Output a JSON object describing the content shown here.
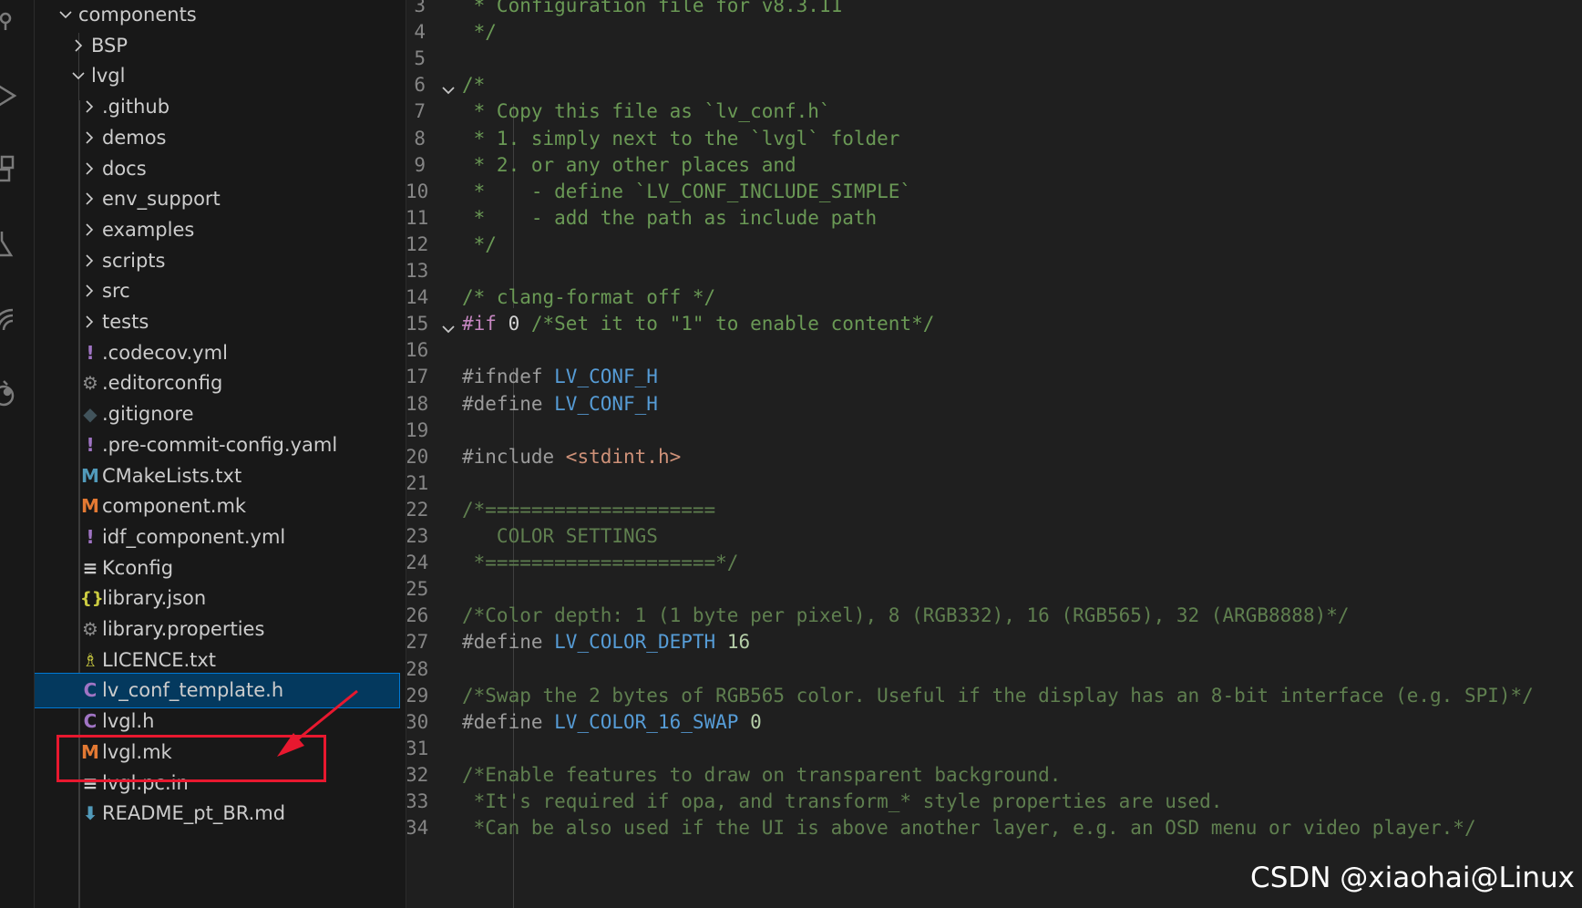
{
  "explorer": {
    "rows": [
      {
        "label": "components",
        "kind": "folder-open",
        "depth": 0,
        "icon": "chevron-down-icon"
      },
      {
        "label": "BSP",
        "kind": "folder",
        "depth": 1,
        "icon": "chevron-right-icon"
      },
      {
        "label": "lvgl",
        "kind": "folder-open",
        "depth": 1,
        "icon": "chevron-down-icon"
      },
      {
        "label": ".github",
        "kind": "folder",
        "depth": 2,
        "icon": "chevron-right-icon"
      },
      {
        "label": "demos",
        "kind": "folder",
        "depth": 2,
        "icon": "chevron-right-icon"
      },
      {
        "label": "docs",
        "kind": "folder",
        "depth": 2,
        "icon": "chevron-right-icon"
      },
      {
        "label": "env_support",
        "kind": "folder",
        "depth": 2,
        "icon": "chevron-right-icon"
      },
      {
        "label": "examples",
        "kind": "folder",
        "depth": 2,
        "icon": "chevron-right-icon"
      },
      {
        "label": "scripts",
        "kind": "folder",
        "depth": 2,
        "icon": "chevron-right-icon"
      },
      {
        "label": "src",
        "kind": "folder",
        "depth": 2,
        "icon": "chevron-right-icon"
      },
      {
        "label": "tests",
        "kind": "folder",
        "depth": 2,
        "icon": "chevron-right-icon"
      },
      {
        "label": ".codecov.yml",
        "kind": "file",
        "depth": 2,
        "icon": "yaml-icon",
        "glyph": "!",
        "color": "#a074c4"
      },
      {
        "label": ".editorconfig",
        "kind": "file",
        "depth": 2,
        "icon": "gear-icon",
        "glyph": "⚙",
        "color": "#8a8a8a"
      },
      {
        "label": ".gitignore",
        "kind": "file",
        "depth": 2,
        "icon": "git-icon",
        "glyph": "◆",
        "color": "#41535b"
      },
      {
        "label": ".pre-commit-config.yaml",
        "kind": "file",
        "depth": 2,
        "icon": "yaml-icon",
        "glyph": "!",
        "color": "#a074c4"
      },
      {
        "label": "CMakeLists.txt",
        "kind": "file",
        "depth": 2,
        "icon": "cmake-icon",
        "glyph": "M",
        "color": "#519aba"
      },
      {
        "label": "component.mk",
        "kind": "file",
        "depth": 2,
        "icon": "makefile-icon",
        "glyph": "M",
        "color": "#e37933"
      },
      {
        "label": "idf_component.yml",
        "kind": "file",
        "depth": 2,
        "icon": "yaml-icon",
        "glyph": "!",
        "color": "#a074c4"
      },
      {
        "label": "Kconfig",
        "kind": "file",
        "depth": 2,
        "icon": "text-lines-icon",
        "glyph": "≡",
        "color": "#cccccc"
      },
      {
        "label": "library.json",
        "kind": "file",
        "depth": 2,
        "icon": "json-icon",
        "glyph": "{}",
        "color": "#cbcb41"
      },
      {
        "label": "library.properties",
        "kind": "file",
        "depth": 2,
        "icon": "gear-icon",
        "glyph": "⚙",
        "color": "#8a8a8a"
      },
      {
        "label": "LICENCE.txt",
        "kind": "file",
        "depth": 2,
        "icon": "license-icon",
        "glyph": "♗",
        "color": "#cbcb41"
      },
      {
        "label": "lv_conf_template.h",
        "kind": "file",
        "depth": 2,
        "icon": "c-header-icon",
        "glyph": "C",
        "color": "#a074c4",
        "selected": true
      },
      {
        "label": "lvgl.h",
        "kind": "file",
        "depth": 2,
        "icon": "c-header-icon",
        "glyph": "C",
        "color": "#a074c4"
      },
      {
        "label": "lvgl.mk",
        "kind": "file",
        "depth": 2,
        "icon": "makefile-icon",
        "glyph": "M",
        "color": "#e37933"
      },
      {
        "label": "lvgl.pc.in",
        "kind": "file",
        "depth": 2,
        "icon": "text-lines-icon",
        "glyph": "≡",
        "color": "#cccccc"
      },
      {
        "label": "README_pt_BR.md",
        "kind": "file",
        "depth": 2,
        "icon": "markdown-icon",
        "glyph": "⬇",
        "color": "#519aba"
      }
    ]
  },
  "editor": {
    "lines": [
      {
        "n": "3",
        "fold": "",
        "tokens": [
          [
            "cm",
            " * Configuration file for v8.3.11"
          ]
        ]
      },
      {
        "n": "4",
        "fold": "",
        "tokens": [
          [
            "cm",
            " */"
          ]
        ]
      },
      {
        "n": "5",
        "fold": "",
        "tokens": []
      },
      {
        "n": "6",
        "fold": "open",
        "tokens": [
          [
            "cm",
            "/*"
          ]
        ]
      },
      {
        "n": "7",
        "fold": "",
        "tokens": [
          [
            "cm",
            " * Copy this file as `lv_conf.h`"
          ]
        ]
      },
      {
        "n": "8",
        "fold": "",
        "tokens": [
          [
            "cm",
            " * 1. simply next to the `lvgl` folder"
          ]
        ]
      },
      {
        "n": "9",
        "fold": "",
        "tokens": [
          [
            "cm",
            " * 2. or any other places and"
          ]
        ]
      },
      {
        "n": "10",
        "fold": "",
        "tokens": [
          [
            "cm",
            " *    - define `LV_CONF_INCLUDE_SIMPLE`"
          ]
        ]
      },
      {
        "n": "11",
        "fold": "",
        "tokens": [
          [
            "cm",
            " *    - add the path as include path"
          ]
        ]
      },
      {
        "n": "12",
        "fold": "",
        "tokens": [
          [
            "cm",
            " */"
          ]
        ]
      },
      {
        "n": "13",
        "fold": "",
        "tokens": []
      },
      {
        "n": "14",
        "fold": "",
        "tokens": [
          [
            "cm",
            "/* clang-format off */"
          ]
        ]
      },
      {
        "n": "15",
        "fold": "open",
        "tokens": [
          [
            "kw",
            "#if"
          ],
          [
            "def",
            " 0 "
          ],
          [
            "cm",
            "/*Set it to \"1\" to enable content*/"
          ]
        ]
      },
      {
        "n": "16",
        "fold": "",
        "tokens": []
      },
      {
        "n": "17",
        "fold": "",
        "tokens": [
          [
            "pp",
            "#ifndef "
          ],
          [
            "mac",
            "LV_CONF_H"
          ]
        ]
      },
      {
        "n": "18",
        "fold": "",
        "tokens": [
          [
            "pp",
            "#define "
          ],
          [
            "mac",
            "LV_CONF_H"
          ]
        ]
      },
      {
        "n": "19",
        "fold": "",
        "tokens": []
      },
      {
        "n": "20",
        "fold": "",
        "tokens": [
          [
            "pp",
            "#include "
          ],
          [
            "str",
            "<stdint.h>"
          ]
        ]
      },
      {
        "n": "21",
        "fold": "",
        "tokens": []
      },
      {
        "n": "22",
        "fold": "",
        "tokens": [
          [
            "dim",
            "/*===================="
          ]
        ]
      },
      {
        "n": "23",
        "fold": "",
        "tokens": [
          [
            "dim",
            "   COLOR SETTINGS"
          ]
        ]
      },
      {
        "n": "24",
        "fold": "",
        "tokens": [
          [
            "dim",
            " *====================*/"
          ]
        ]
      },
      {
        "n": "25",
        "fold": "",
        "tokens": []
      },
      {
        "n": "26",
        "fold": "",
        "tokens": [
          [
            "dim",
            "/*Color depth: 1 (1 byte per pixel), 8 (RGB332), 16 (RGB565), 32 (ARGB8888)*/"
          ]
        ]
      },
      {
        "n": "27",
        "fold": "",
        "tokens": [
          [
            "pp",
            "#define "
          ],
          [
            "mac",
            "LV_COLOR_DEPTH"
          ],
          [
            "num",
            " 16"
          ]
        ]
      },
      {
        "n": "28",
        "fold": "",
        "tokens": []
      },
      {
        "n": "29",
        "fold": "",
        "tokens": [
          [
            "dim",
            "/*Swap the 2 bytes of RGB565 color. Useful if the display has an 8-bit interface (e.g. SPI)*/"
          ]
        ]
      },
      {
        "n": "30",
        "fold": "",
        "tokens": [
          [
            "pp",
            "#define "
          ],
          [
            "mac",
            "LV_COLOR_16_SWAP"
          ],
          [
            "num",
            " 0"
          ]
        ]
      },
      {
        "n": "31",
        "fold": "",
        "tokens": []
      },
      {
        "n": "32",
        "fold": "",
        "tokens": [
          [
            "dim",
            "/*Enable features to draw on transparent background."
          ]
        ]
      },
      {
        "n": "33",
        "fold": "",
        "tokens": [
          [
            "dim",
            " *It's required if opa, and transform_* style properties are used."
          ]
        ]
      },
      {
        "n": "34",
        "fold": "",
        "tokens": [
          [
            "dim",
            " *Can be also used if the UI is above another layer, e.g. an OSD menu or video player.*/"
          ]
        ]
      }
    ]
  },
  "watermark": "CSDN @xiaohai@Linux"
}
